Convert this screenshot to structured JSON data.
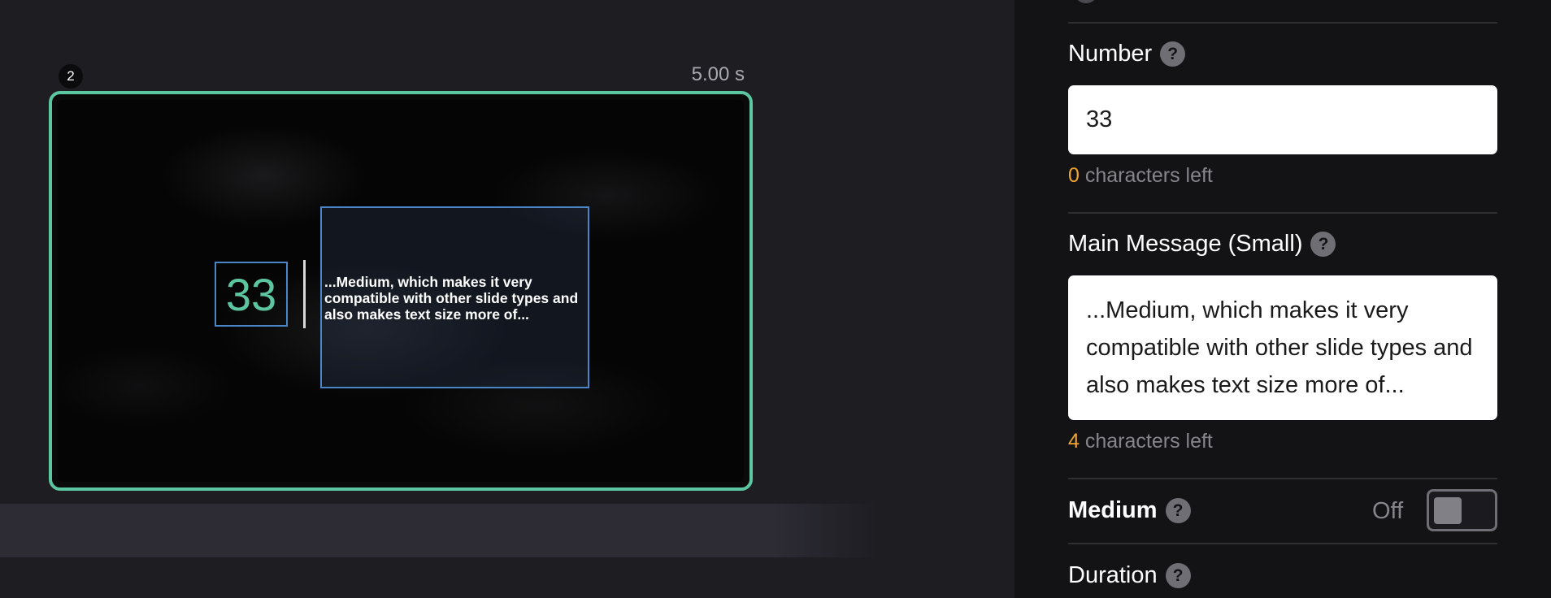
{
  "slide": {
    "index": "2",
    "duration": "5.00 s",
    "preview_number": "33",
    "preview_message": "...Medium, which makes it very compatible with other slide types and also makes text size more of..."
  },
  "panel": {
    "number_field": {
      "label": "Number",
      "help": "?",
      "value": "33",
      "counter_value": "0",
      "counter_suffix": " characters left"
    },
    "message_field": {
      "label": "Main Message (Small)",
      "help": "?",
      "value": "...Medium, which makes it very compatible with other slide types and also makes text size more of...",
      "counter_value": "4",
      "counter_suffix": " characters left"
    },
    "medium_toggle": {
      "label": "Medium",
      "help": "?",
      "state": "Off"
    },
    "duration_field": {
      "label": "Duration",
      "help": "?"
    }
  },
  "colors": {
    "accent": "#5cc6a0",
    "counter": "#f0a530",
    "box_outline": "#4a86c5"
  }
}
